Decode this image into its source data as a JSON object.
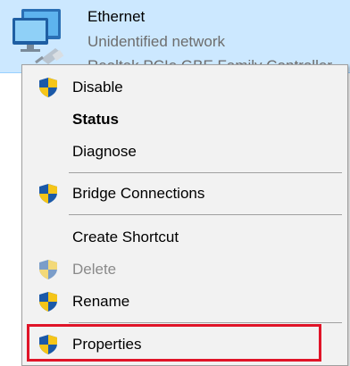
{
  "adapter": {
    "name": "Ethernet",
    "status": "Unidentified network",
    "device": "Realtek PCIe GBE Family Controller",
    "icon": "network-adapter-icon"
  },
  "menu": {
    "items": [
      {
        "label": "Disable",
        "icon": "uac-shield-icon"
      },
      {
        "label": "Status"
      },
      {
        "label": "Diagnose"
      },
      {
        "label": "Bridge Connections",
        "icon": "uac-shield-icon"
      },
      {
        "label": "Create Shortcut"
      },
      {
        "label": "Delete",
        "icon": "uac-shield-icon",
        "disabled": true
      },
      {
        "label": "Rename",
        "icon": "uac-shield-icon"
      },
      {
        "label": "Properties",
        "icon": "uac-shield-icon"
      }
    ]
  },
  "colors": {
    "selection_bg": "#cce8ff",
    "menu_bg": "#f2f2f2",
    "highlight_outline": "#e01428"
  }
}
